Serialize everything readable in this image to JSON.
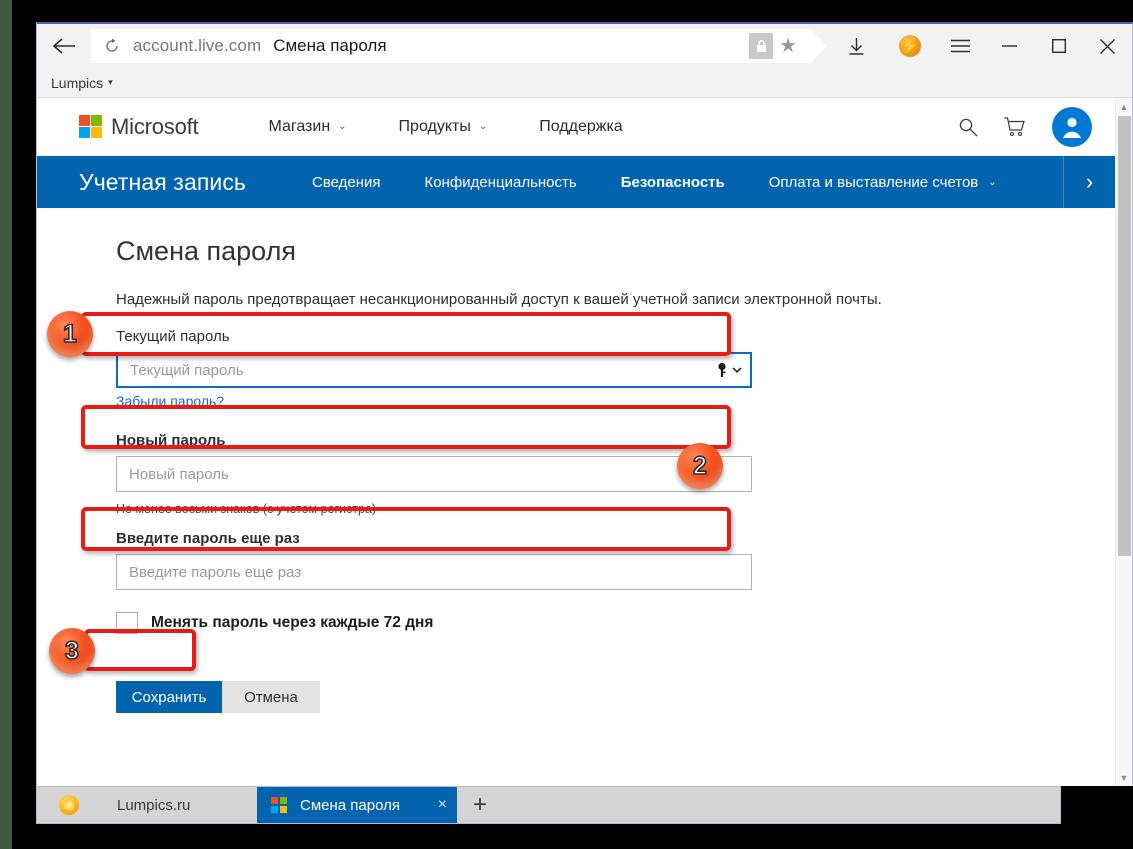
{
  "browser": {
    "back_icon": "back-arrow-icon",
    "refresh_icon": "refresh-icon",
    "address_domain": "account.live.com",
    "address_title": "Смена пароля",
    "lock_icon": "lock-icon",
    "star_icon": "star-icon",
    "download_icon": "download-icon",
    "flash_icon": "flash-badge-icon",
    "menu_icon": "hamburger-menu-icon",
    "minimize_icon": "minimize-icon",
    "maximize_icon": "maximize-icon",
    "close_icon": "close-icon",
    "bookmark_label": "Lumpics",
    "bookmark_caret": "▾"
  },
  "ms_header": {
    "brand": "Microsoft",
    "nav": [
      {
        "label": "Магазин",
        "has_caret": true
      },
      {
        "label": "Продукты",
        "has_caret": true
      },
      {
        "label": "Поддержка",
        "has_caret": false
      }
    ],
    "search_icon": "search-icon",
    "cart_icon": "shopping-cart-icon",
    "avatar_icon": "user-avatar-icon"
  },
  "account_nav": {
    "title": "Учетная запись",
    "items": [
      {
        "label": "Сведения",
        "active": false,
        "caret": false
      },
      {
        "label": "Конфиденциальность",
        "active": false,
        "caret": false
      },
      {
        "label": "Безопасность",
        "active": true,
        "caret": false
      },
      {
        "label": "Оплата и выставление счетов",
        "active": false,
        "caret": true
      }
    ],
    "more_icon": "chevron-right-icon",
    "accent_color": "#0263ae"
  },
  "page": {
    "title": "Смена пароля",
    "description": "Надежный пароль предотвращает несанкционированный доступ к вашей учетной записи электронной почты.",
    "current_password": {
      "label": "Текущий пароль",
      "placeholder": "Текущий пароль",
      "value": "",
      "reveal_icon": "key-reveal-icon",
      "forgot_link": "Забыли пароль?"
    },
    "new_password": {
      "label": "Новый пароль",
      "placeholder": "Новый пароль",
      "value": "",
      "hint": "Не менее восьми знаков (с учетом регистра)"
    },
    "confirm_password": {
      "label": "Введите пароль еще раз",
      "placeholder": "Введите пароль еще раз",
      "value": ""
    },
    "checkbox": {
      "label": "Менять пароль через каждые 72 дня",
      "checked": false
    },
    "save_button": "Сохранить",
    "cancel_button": "Отмена"
  },
  "annotations": {
    "badge_1": "1",
    "badge_2": "2",
    "badge_3": "3",
    "highlight_color": "#e81b17"
  },
  "taskbar": {
    "favorite_label": "Lumpics.ru",
    "favorite_icon": "lumpics-favicon",
    "tab_label": "Смена пароля",
    "tab_icon": "microsoft-favicon",
    "tab_close_icon": "×",
    "new_tab_icon": "+"
  }
}
